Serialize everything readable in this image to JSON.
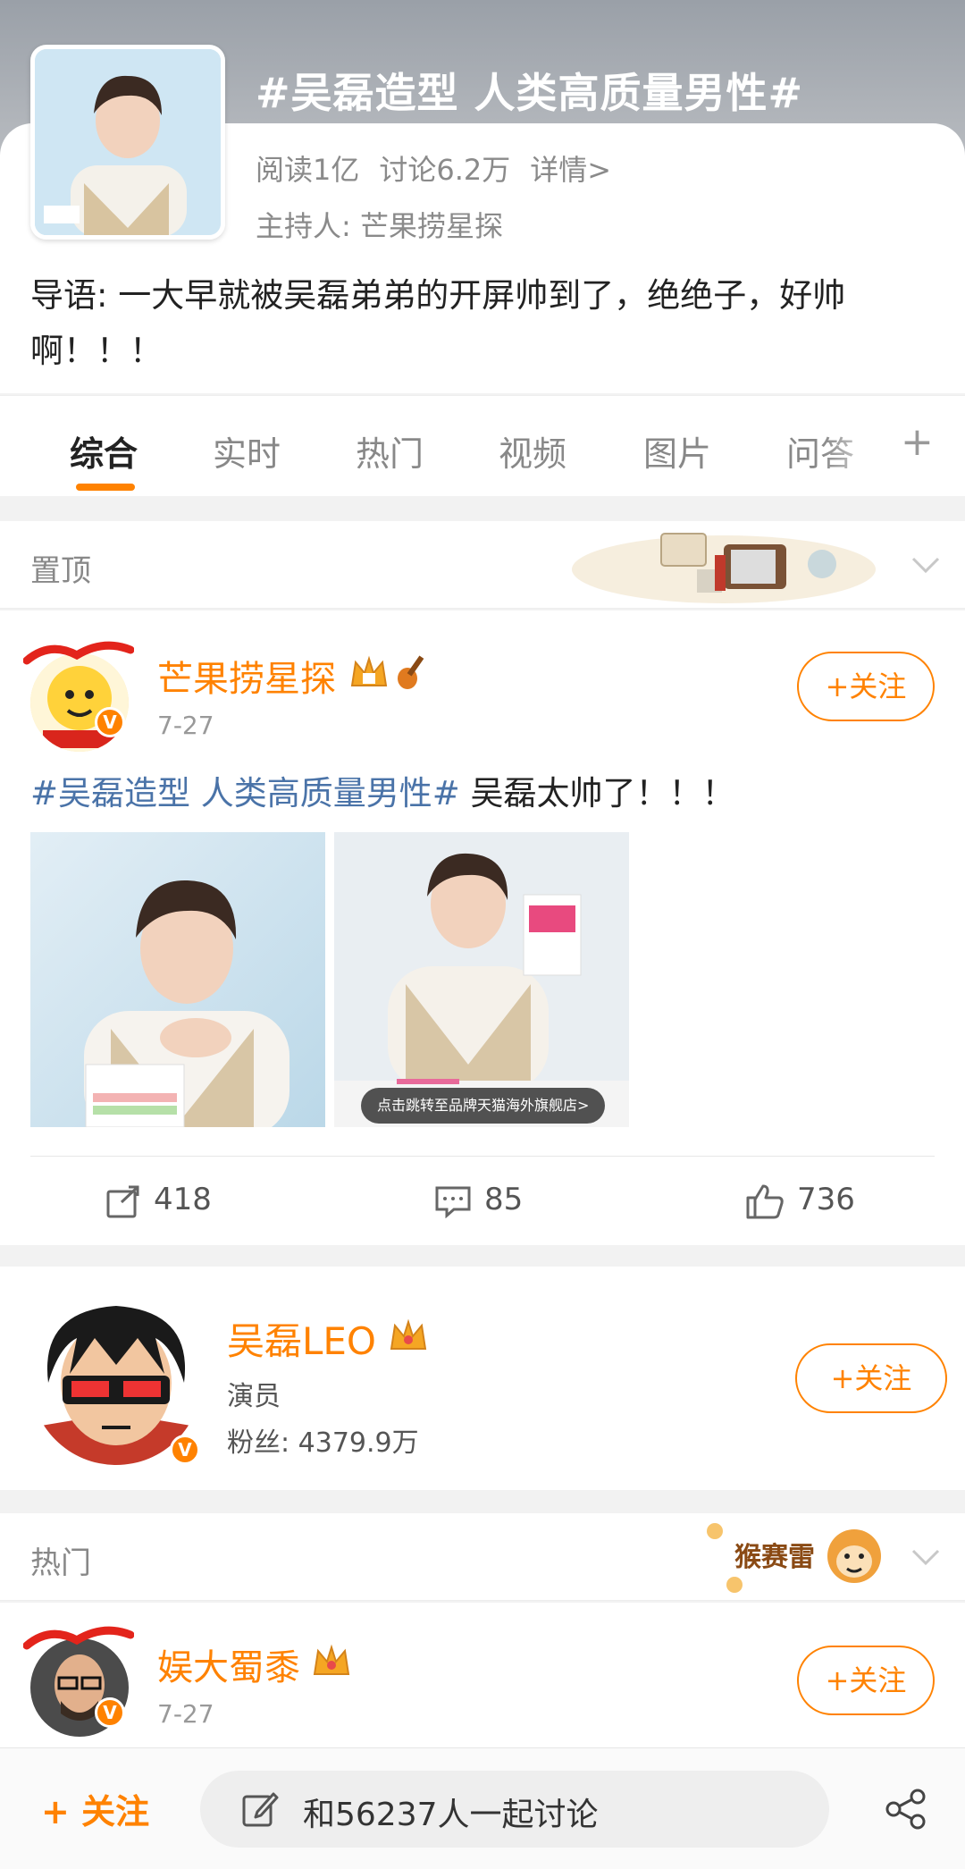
{
  "topic": {
    "title": "#吴磊造型 人类高质量男性#",
    "reads": "阅读1亿",
    "discussions": "讨论6.2万",
    "details_link": "详情>",
    "host": "主持人: 芒果捞星探",
    "lead": "导语: 一大早就被吴磊弟弟的开屏帅到了，绝绝子，好帅啊！！！"
  },
  "tabs": [
    "综合",
    "实时",
    "热门",
    "视频",
    "图片",
    "问答"
  ],
  "pinned_section": {
    "label": "置顶"
  },
  "pinned_post": {
    "username": "芒果捞星探",
    "date": "7-27",
    "follow_label": "+关注",
    "hashtag": "#吴磊造型 人类高质量男性#",
    "text": " 吴磊太帅了！！！",
    "image_caption": "点击跳转至品牌天猫海外旗舰店>",
    "reposts": "418",
    "comments": "85",
    "likes": "736"
  },
  "user_card": {
    "name": "吴磊LEO",
    "role": "演员",
    "followers": "粉丝: 4379.9万",
    "follow_label": "+关注"
  },
  "hot_section": {
    "label": "热门",
    "sticker_text": "猴赛雷"
  },
  "hot_post": {
    "username": "娱大蜀黍",
    "date": "7-27",
    "follow_label": "+关注"
  },
  "bottom_bar": {
    "follow_label": "+ 关注",
    "input_placeholder": "和56237人一起讨论"
  },
  "colors": {
    "accent": "#ff8200",
    "link": "#4a73a8"
  }
}
